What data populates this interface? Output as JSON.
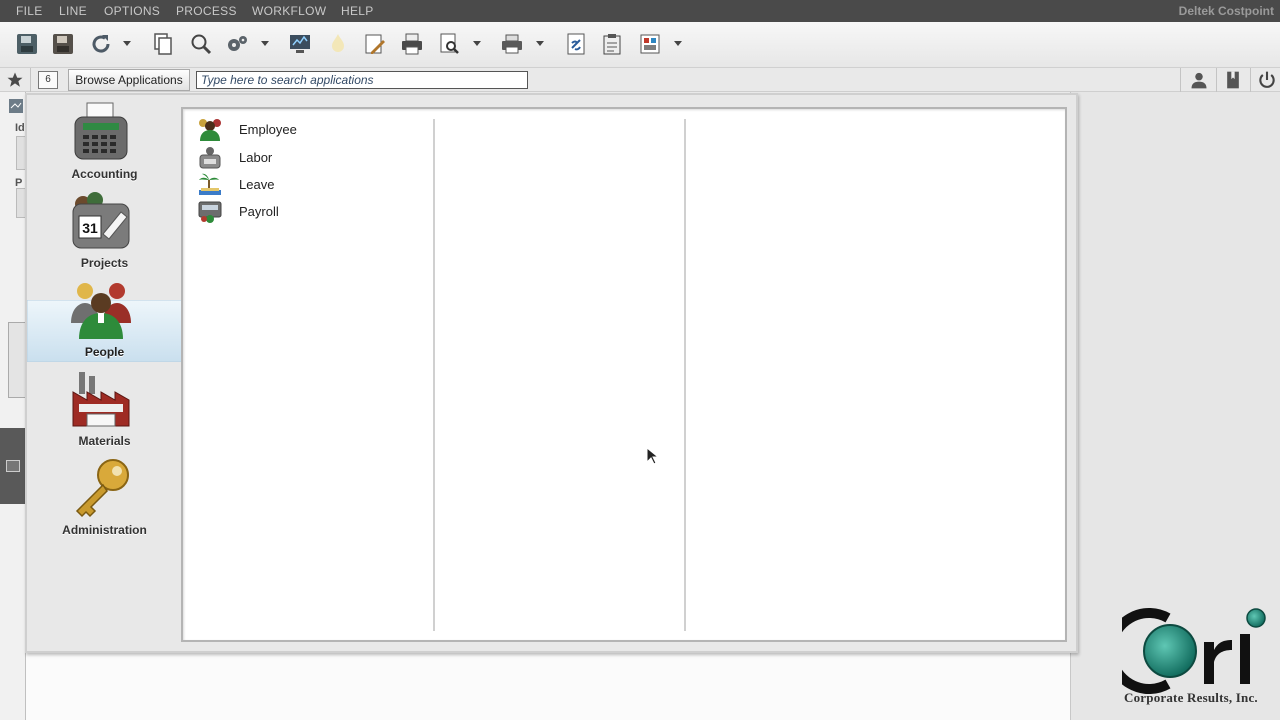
{
  "menu": [
    "FILE",
    "LINE",
    "OPTIONS",
    "PROCESS",
    "WORKFLOW",
    "HELP"
  ],
  "app_title": "Deltek Costpoint",
  "appbar": {
    "calendar_number": "6",
    "browse_label": "Browse Applications",
    "search_placeholder": "Type here to search applications"
  },
  "categories": [
    {
      "label": "Accounting",
      "icon": "accounting-icon"
    },
    {
      "label": "Projects",
      "icon": "projects-icon"
    },
    {
      "label": "People",
      "icon": "people-icon",
      "selected": true
    },
    {
      "label": "Materials",
      "icon": "materials-icon"
    },
    {
      "label": "Administration",
      "icon": "administration-icon"
    }
  ],
  "projects_calendar_number": "31",
  "applications": [
    {
      "label": "Employee",
      "icon": "employee-icon"
    },
    {
      "label": "Labor",
      "icon": "labor-icon"
    },
    {
      "label": "Leave",
      "icon": "leave-icon"
    },
    {
      "label": "Payroll",
      "icon": "payroll-icon"
    }
  ],
  "left_fragments": [
    "Id",
    "P"
  ],
  "logo": {
    "letters": "cri",
    "company": "Corporate Results, Inc."
  },
  "colors": {
    "menubar": "#4a4a4a",
    "logo_teal": "#1f8a7a",
    "selected_tab": "#d3e7f4"
  }
}
